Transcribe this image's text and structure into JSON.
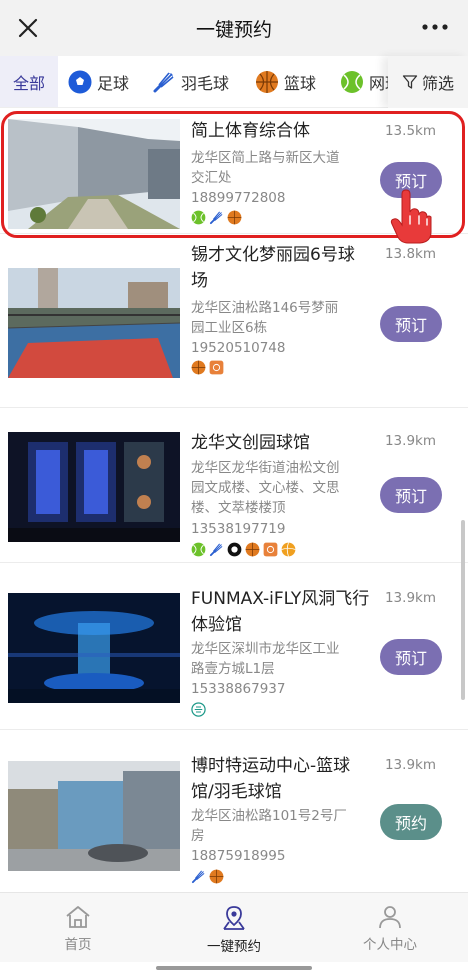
{
  "header": {
    "title": "一键预约"
  },
  "categories": [
    {
      "label": "全部",
      "icon": "all",
      "active": true
    },
    {
      "label": "足球",
      "icon": "soccer-ball-icon"
    },
    {
      "label": "羽毛球",
      "icon": "shuttlecock-icon"
    },
    {
      "label": "篮球",
      "icon": "basketball-icon"
    },
    {
      "label": "网球",
      "icon": "tennis-ball-icon"
    }
  ],
  "filter": {
    "label": "筛选"
  },
  "venues": [
    {
      "name": "简上体育综合体",
      "distance": "13.5km",
      "address": "龙华区简上路与新区大道交汇处",
      "phone": "18899772808",
      "sports": [
        "tennis-ball-icon",
        "shuttlecock-icon",
        "basketball-icon"
      ],
      "button": "预订"
    },
    {
      "name": "锡才文化梦丽园6号球场",
      "distance": "13.8km",
      "address": "龙华区油松路146号梦丽园工业区6栋",
      "phone": "19520510748",
      "sports": [
        "basketball-icon",
        "court-icon"
      ],
      "button": "预订"
    },
    {
      "name": "龙华文创园球馆",
      "distance": "13.9km",
      "address": "龙华区龙华街道油松文创园文成楼、文心楼、文思楼、文萃楼楼顶",
      "phone": "13538197719",
      "sports": [
        "tennis-ball-icon",
        "shuttlecock-icon",
        "billiards-icon",
        "basketball-icon",
        "court-icon",
        "volleyball-icon"
      ],
      "button": "预订"
    },
    {
      "name": "FUNMAX-iFLY风洞飞行体验馆",
      "distance": "13.9km",
      "address": "龙华区深圳市龙华区工业路壹方城L1层",
      "phone": "15338867937",
      "sports": [
        "wind-tunnel-icon"
      ],
      "button": "预订"
    },
    {
      "name": "博时特运动中心-篮球馆/羽毛球馆",
      "distance": "13.9km",
      "address": "龙华区油松路101号2号厂房",
      "phone": "18875918995",
      "sports": [
        "shuttlecock-icon",
        "basketball-icon"
      ],
      "button": "预约"
    }
  ],
  "tabbar": [
    {
      "label": "首页",
      "icon": "home-icon"
    },
    {
      "label": "一键预约",
      "icon": "location-pin-icon",
      "active": true
    },
    {
      "label": "个人中心",
      "icon": "user-icon"
    }
  ],
  "colors": {
    "accent": "#7b6fb2",
    "teal_button": "#5b8f8a",
    "highlight": "#e02020"
  }
}
